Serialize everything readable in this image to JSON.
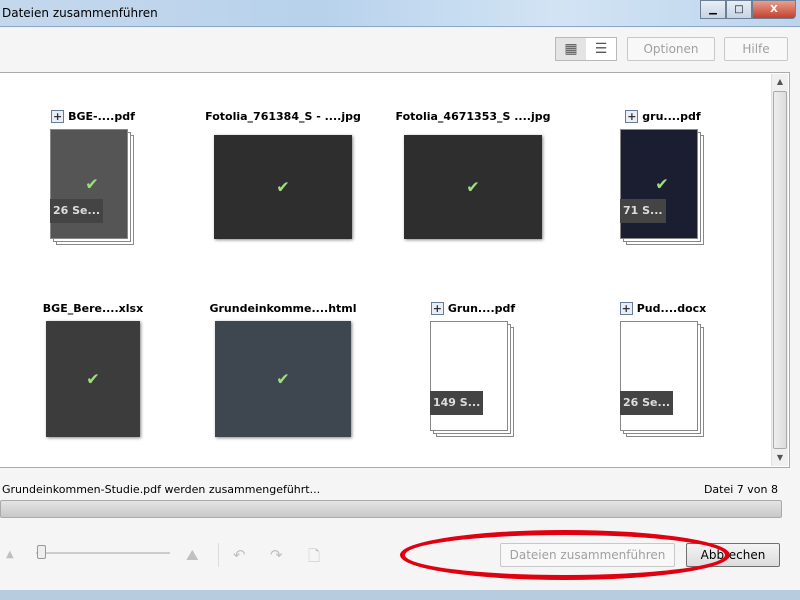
{
  "window": {
    "title": "Dateien zusammenführen"
  },
  "toolbar": {
    "options_label": "Optionen",
    "help_label": "Hilfe",
    "view_grid_icon": "grid-view-icon",
    "view_list_icon": "list-view-icon"
  },
  "files": [
    {
      "name": "BGE-....pdf",
      "expandable": true,
      "pages": "26 Se...",
      "kind": "doc"
    },
    {
      "name": "Fotolia_761384_S - ....jpg",
      "expandable": false,
      "kind": "photo"
    },
    {
      "name": "Fotolia_4671353_S ....jpg",
      "expandable": false,
      "kind": "photo"
    },
    {
      "name": "gru....pdf",
      "expandable": true,
      "pages": "71 S...",
      "kind": "doc-dark"
    },
    {
      "name": "BGE_Bere....xlsx",
      "expandable": false,
      "kind": "sheet"
    },
    {
      "name": "Grundeinkomme....html",
      "expandable": false,
      "kind": "web"
    },
    {
      "name": "Grun....pdf",
      "expandable": true,
      "pages": "149 S...",
      "kind": "doc-white"
    },
    {
      "name": "Pud....docx",
      "expandable": true,
      "pages": "26 Se...",
      "kind": "doc-white"
    }
  ],
  "status": {
    "message": "Grundeinkommen-Studie.pdf werden zusammengeführt...",
    "count": "Datei 7 von 8",
    "progress_percent": 100
  },
  "footer": {
    "merge_label": "Dateien zusammenführen",
    "cancel_label": "Abbrechen",
    "zoom_level": 0.05
  },
  "colors": {
    "highlight_oval": "#e00010",
    "check": "#9de07a"
  }
}
